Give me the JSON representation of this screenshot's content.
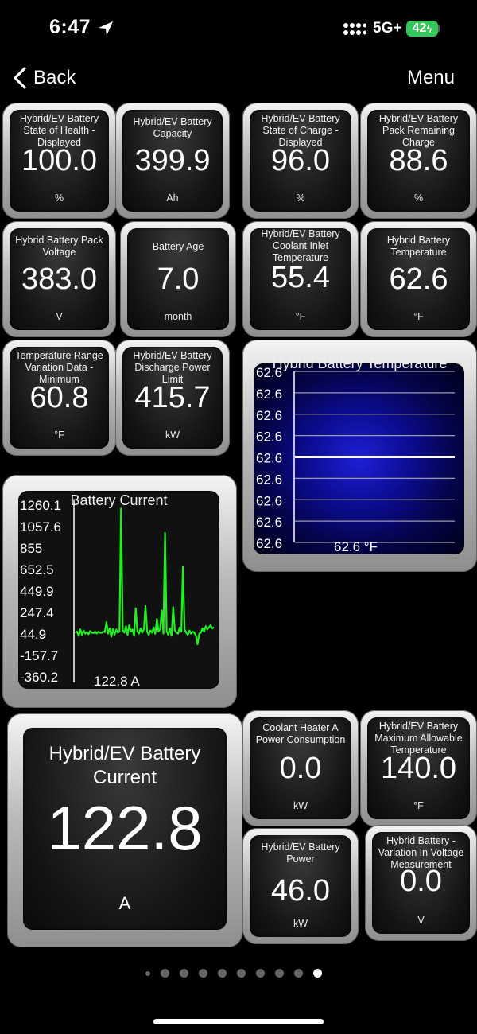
{
  "status": {
    "time": "6:47",
    "network": "5G+",
    "battery": "42"
  },
  "nav": {
    "back_label": "Back",
    "menu_label": "Menu"
  },
  "tiles": {
    "soh": {
      "label": "Hybrid/EV Battery State of Health - Displayed",
      "value": "100.0",
      "unit": "%"
    },
    "capacity": {
      "label": "Hybrid/EV Battery Capacity",
      "value": "399.9",
      "unit": "Ah"
    },
    "soc": {
      "label": "Hybrid/EV Battery State of Charge - Displayed",
      "value": "96.0",
      "unit": "%"
    },
    "remaining": {
      "label": "Hybrid/EV Battery Pack Remaining Charge",
      "value": "88.6",
      "unit": "%"
    },
    "pack_voltage": {
      "label": "Hybrid Battery Pack Voltage",
      "value": "383.0",
      "unit": "V"
    },
    "age": {
      "label": "Battery Age",
      "value": "7.0",
      "unit": "month"
    },
    "coolant_inlet": {
      "label": "Hybrid/EV Battery Coolant Inlet Temperature",
      "value": "55.4",
      "unit": "°F"
    },
    "batt_temp": {
      "label": "Hybrid Battery Temperature",
      "value": "62.6",
      "unit": "°F"
    },
    "temp_min": {
      "label": "Temperature Range Variation Data - Minimum",
      "value": "60.8",
      "unit": "°F"
    },
    "discharge_limit": {
      "label": "Hybrid/EV Battery Discharge Power Limit",
      "value": "415.7",
      "unit": "kW"
    },
    "heater": {
      "label": "Coolant Heater A Power Consumption",
      "value": "0.0",
      "unit": "kW"
    },
    "max_temp": {
      "label": "Hybrid/EV Battery Maximum Allowable Temperature",
      "value": "140.0",
      "unit": "°F"
    },
    "power": {
      "label": "Hybrid/EV Battery Power",
      "value": "46.0",
      "unit": "kW"
    },
    "volt_var": {
      "label": "Hybrid Battery - Variation In Voltage Measurement",
      "value": "0.0",
      "unit": "V"
    },
    "big_current": {
      "label": "Hybrid/EV Battery Current",
      "value": "122.8",
      "unit": "A"
    }
  },
  "temp_graph": {
    "title": "Hybrid Battery Temperature",
    "ticks": [
      "62.6",
      "62.6",
      "62.6",
      "62.6",
      "62.6",
      "62.6",
      "62.6",
      "62.6",
      "62.6"
    ],
    "current": "62.6 °F",
    "value": 62.6
  },
  "current_graph": {
    "title": "Battery Current",
    "ticks": [
      "1260.1",
      "1057.6",
      "855",
      "652.5",
      "449.9",
      "247.4",
      "44.9",
      "-157.7",
      "-360.2"
    ],
    "current": "122.8 A",
    "ylim": [
      -360.2,
      1260.1
    ],
    "colors": {
      "line": "#22ee22"
    },
    "values": [
      45,
      60,
      20,
      80,
      30,
      70,
      40,
      55,
      35,
      65,
      50,
      45,
      60,
      42,
      58,
      50,
      48,
      60,
      55,
      150,
      40,
      90,
      10,
      85,
      30,
      80,
      50,
      60,
      1220,
      70,
      50,
      110,
      30,
      120,
      60,
      80,
      20,
      280,
      60,
      40,
      90,
      50,
      80,
      300,
      60,
      30,
      70,
      50,
      100,
      40,
      180,
      60,
      80,
      260,
      40,
      990,
      60,
      30,
      90,
      20,
      290,
      70,
      50,
      40,
      100,
      60,
      670,
      80,
      50,
      30,
      70,
      40,
      60,
      50,
      20,
      -60,
      40,
      50,
      90,
      60,
      110,
      80,
      100,
      120,
      90,
      100
    ]
  },
  "pager": {
    "count": 10,
    "active": 9
  }
}
